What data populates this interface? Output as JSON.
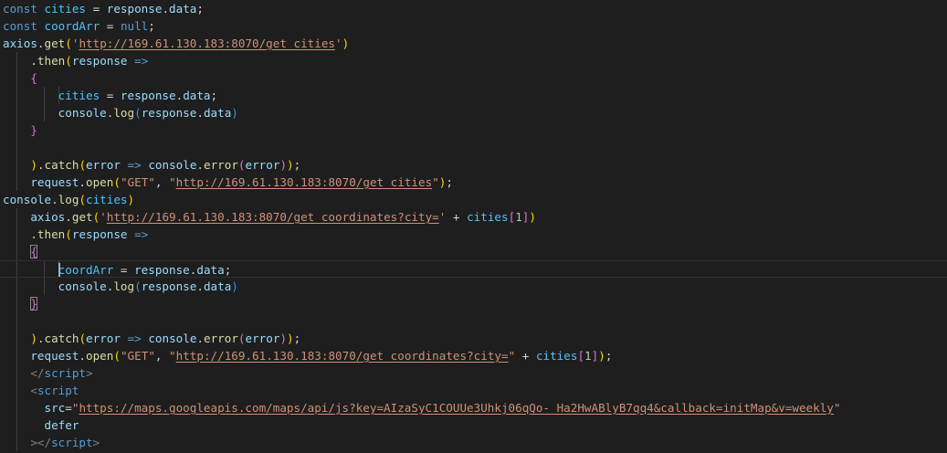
{
  "editor": {
    "theme": "dark",
    "background": "#1e1e1e",
    "current_line": 16,
    "lines": [
      {
        "tokens": [
          {
            "t": "const",
            "c": "kw"
          },
          {
            "t": " "
          },
          {
            "t": "cities",
            "c": "var"
          },
          {
            "t": " = "
          },
          {
            "t": "response",
            "c": "id"
          },
          {
            "t": "."
          },
          {
            "t": "data",
            "c": "id"
          },
          {
            "t": ";"
          }
        ]
      },
      {
        "tokens": [
          {
            "t": "const",
            "c": "kw"
          },
          {
            "t": " "
          },
          {
            "t": "coordArr",
            "c": "var"
          },
          {
            "t": " = "
          },
          {
            "t": "null",
            "c": "kw"
          },
          {
            "t": ";"
          }
        ]
      },
      {
        "tokens": [
          {
            "t": "axios",
            "c": "id"
          },
          {
            "t": "."
          },
          {
            "t": "get",
            "c": "fn"
          },
          {
            "t": "(",
            "c": "b1"
          },
          {
            "t": "'",
            "c": "str"
          },
          {
            "t": "http://169.61.130.183:8070/get_cities",
            "c": "url"
          },
          {
            "t": "'",
            "c": "str"
          },
          {
            "t": ")",
            "c": "b1"
          }
        ]
      },
      {
        "guides": [
          1
        ],
        "tokens": [
          {
            "t": "    ."
          },
          {
            "t": "then",
            "c": "fn"
          },
          {
            "t": "(",
            "c": "b1"
          },
          {
            "t": "response",
            "c": "id"
          },
          {
            "t": " "
          },
          {
            "t": "=>",
            "c": "kw"
          }
        ]
      },
      {
        "guides": [
          1
        ],
        "tokens": [
          {
            "t": "    "
          },
          {
            "t": "{",
            "c": "b2"
          }
        ]
      },
      {
        "guides": [
          1,
          2,
          3
        ],
        "tokens": [
          {
            "t": "        "
          },
          {
            "t": "cities",
            "c": "var"
          },
          {
            "t": " = "
          },
          {
            "t": "response",
            "c": "id"
          },
          {
            "t": "."
          },
          {
            "t": "data",
            "c": "id"
          },
          {
            "t": ";"
          }
        ]
      },
      {
        "guides": [
          1,
          2
        ],
        "tokens": [
          {
            "t": "        "
          },
          {
            "t": "console",
            "c": "id"
          },
          {
            "t": "."
          },
          {
            "t": "log",
            "c": "fn"
          },
          {
            "t": "(",
            "c": "b3"
          },
          {
            "t": "response",
            "c": "id"
          },
          {
            "t": "."
          },
          {
            "t": "data",
            "c": "id"
          },
          {
            "t": ")",
            "c": "b3"
          }
        ]
      },
      {
        "guides": [
          1
        ],
        "tokens": [
          {
            "t": "    "
          },
          {
            "t": "}",
            "c": "b2"
          }
        ]
      },
      {
        "guides": [
          1
        ],
        "tokens": []
      },
      {
        "guides": [
          1
        ],
        "tokens": [
          {
            "t": "    "
          },
          {
            "t": ")",
            "c": "b1"
          },
          {
            "t": "."
          },
          {
            "t": "catch",
            "c": "fn"
          },
          {
            "t": "(",
            "c": "b1"
          },
          {
            "t": "error",
            "c": "id"
          },
          {
            "t": " "
          },
          {
            "t": "=>",
            "c": "kw"
          },
          {
            "t": " "
          },
          {
            "t": "console",
            "c": "id"
          },
          {
            "t": "."
          },
          {
            "t": "error",
            "c": "fn"
          },
          {
            "t": "(",
            "c": "b2"
          },
          {
            "t": "error",
            "c": "id"
          },
          {
            "t": ")",
            "c": "b2"
          },
          {
            "t": ")",
            "c": "b1"
          },
          {
            "t": ";"
          }
        ]
      },
      {
        "guides": [
          1
        ],
        "tokens": [
          {
            "t": "    "
          },
          {
            "t": "request",
            "c": "id"
          },
          {
            "t": "."
          },
          {
            "t": "open",
            "c": "fn"
          },
          {
            "t": "(",
            "c": "b1"
          },
          {
            "t": "\"GET\"",
            "c": "str"
          },
          {
            "t": ", "
          },
          {
            "t": "\"",
            "c": "str"
          },
          {
            "t": "http://169.61.130.183:8070/get_cities",
            "c": "url"
          },
          {
            "t": "\"",
            "c": "str"
          },
          {
            "t": ")",
            "c": "b1"
          },
          {
            "t": ";"
          }
        ]
      },
      {
        "tokens": [
          {
            "t": "console",
            "c": "id"
          },
          {
            "t": "."
          },
          {
            "t": "log",
            "c": "fn"
          },
          {
            "t": "(",
            "c": "b1"
          },
          {
            "t": "cities",
            "c": "var"
          },
          {
            "t": ")",
            "c": "b1"
          }
        ]
      },
      {
        "guides": [
          1
        ],
        "tokens": [
          {
            "t": "    "
          },
          {
            "t": "axios",
            "c": "id"
          },
          {
            "t": "."
          },
          {
            "t": "get",
            "c": "fn"
          },
          {
            "t": "(",
            "c": "b1"
          },
          {
            "t": "'",
            "c": "str"
          },
          {
            "t": "http://169.61.130.183:8070/get_coordinates?city=",
            "c": "url"
          },
          {
            "t": "'",
            "c": "str"
          },
          {
            "t": " + "
          },
          {
            "t": "cities",
            "c": "var"
          },
          {
            "t": "[",
            "c": "b2"
          },
          {
            "t": "1",
            "c": "num"
          },
          {
            "t": "]",
            "c": "b2"
          },
          {
            "t": ")",
            "c": "b1"
          }
        ]
      },
      {
        "guides": [
          1
        ],
        "tokens": [
          {
            "t": "    ."
          },
          {
            "t": "then",
            "c": "fn"
          },
          {
            "t": "(",
            "c": "b1"
          },
          {
            "t": "response",
            "c": "id"
          },
          {
            "t": " "
          },
          {
            "t": "=>",
            "c": "kw"
          }
        ]
      },
      {
        "guides": [
          1
        ],
        "tokens": [
          {
            "t": "    "
          },
          {
            "t": "{",
            "c": "b2 bm"
          }
        ]
      },
      {
        "guides": [
          1,
          2,
          3
        ],
        "active_guide": 3,
        "caret": true,
        "tokens": [
          {
            "t": "        "
          },
          {
            "t": "coordArr",
            "c": "var"
          },
          {
            "t": " = "
          },
          {
            "t": "response",
            "c": "id"
          },
          {
            "t": "."
          },
          {
            "t": "data",
            "c": "id"
          },
          {
            "t": ";"
          }
        ]
      },
      {
        "guides": [
          1,
          2
        ],
        "tokens": [
          {
            "t": "        "
          },
          {
            "t": "console",
            "c": "id"
          },
          {
            "t": "."
          },
          {
            "t": "log",
            "c": "fn"
          },
          {
            "t": "(",
            "c": "b3"
          },
          {
            "t": "response",
            "c": "id"
          },
          {
            "t": "."
          },
          {
            "t": "data",
            "c": "id"
          },
          {
            "t": ")",
            "c": "b3"
          }
        ]
      },
      {
        "guides": [
          1
        ],
        "tokens": [
          {
            "t": "    "
          },
          {
            "t": "}",
            "c": "b2 bm"
          }
        ]
      },
      {
        "guides": [
          1
        ],
        "tokens": []
      },
      {
        "guides": [
          1
        ],
        "tokens": [
          {
            "t": "    "
          },
          {
            "t": ")",
            "c": "b1"
          },
          {
            "t": "."
          },
          {
            "t": "catch",
            "c": "fn"
          },
          {
            "t": "(",
            "c": "b1"
          },
          {
            "t": "error",
            "c": "id"
          },
          {
            "t": " "
          },
          {
            "t": "=>",
            "c": "kw"
          },
          {
            "t": " "
          },
          {
            "t": "console",
            "c": "id"
          },
          {
            "t": "."
          },
          {
            "t": "error",
            "c": "fn"
          },
          {
            "t": "(",
            "c": "b2"
          },
          {
            "t": "error",
            "c": "id"
          },
          {
            "t": ")",
            "c": "b2"
          },
          {
            "t": ")",
            "c": "b1"
          },
          {
            "t": ";"
          }
        ]
      },
      {
        "guides": [
          1
        ],
        "tokens": [
          {
            "t": "    "
          },
          {
            "t": "request",
            "c": "id"
          },
          {
            "t": "."
          },
          {
            "t": "open",
            "c": "fn"
          },
          {
            "t": "(",
            "c": "b1"
          },
          {
            "t": "\"GET\"",
            "c": "str"
          },
          {
            "t": ", "
          },
          {
            "t": "\"",
            "c": "str"
          },
          {
            "t": "http://169.61.130.183:8070/get_coordinates?city=",
            "c": "url"
          },
          {
            "t": "\"",
            "c": "str"
          },
          {
            "t": " + "
          },
          {
            "t": "cities",
            "c": "var"
          },
          {
            "t": "[",
            "c": "b2"
          },
          {
            "t": "1",
            "c": "num"
          },
          {
            "t": "]",
            "c": "b2"
          },
          {
            "t": ")",
            "c": "b1"
          },
          {
            "t": ";"
          }
        ]
      },
      {
        "guides": [
          1
        ],
        "tokens": [
          {
            "t": "    "
          },
          {
            "t": "</",
            "c": "tag"
          },
          {
            "t": "script",
            "c": "tagname"
          },
          {
            "t": ">",
            "c": "tag"
          }
        ]
      },
      {
        "guides": [
          1
        ],
        "tokens": [
          {
            "t": "    "
          },
          {
            "t": "<",
            "c": "tag"
          },
          {
            "t": "script",
            "c": "tagname"
          }
        ]
      },
      {
        "guides": [
          1
        ],
        "tokens": [
          {
            "t": "      "
          },
          {
            "t": "src",
            "c": "attr"
          },
          {
            "t": "="
          },
          {
            "t": "\"",
            "c": "str"
          },
          {
            "t": "https://maps.googleapis.com/maps/api/js?key=AIzaSyC1COUUe3Uhkj06qQo-_Ha2HwABlyB7qq4&callback=initMap&v=weekly",
            "c": "url"
          },
          {
            "t": "\"",
            "c": "str"
          }
        ]
      },
      {
        "guides": [
          1
        ],
        "tokens": [
          {
            "t": "      "
          },
          {
            "t": "defer",
            "c": "attr"
          }
        ]
      },
      {
        "guides": [
          1
        ],
        "tokens": [
          {
            "t": "    "
          },
          {
            "t": "></",
            "c": "tag"
          },
          {
            "t": "script",
            "c": "tagname"
          },
          {
            "t": ">",
            "c": "tag"
          }
        ]
      }
    ]
  }
}
